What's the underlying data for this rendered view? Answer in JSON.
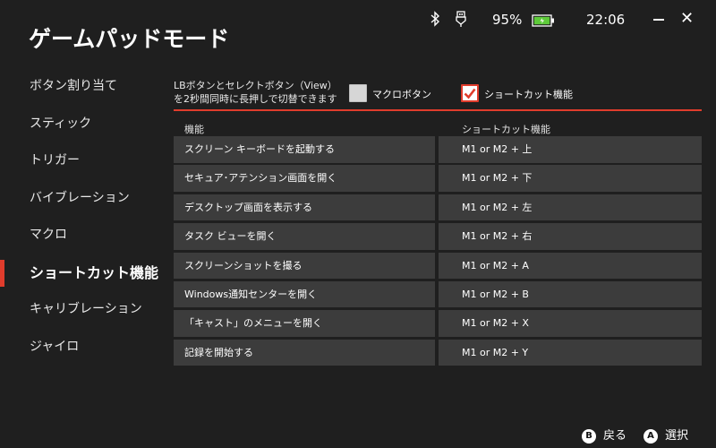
{
  "header": {
    "title": "ゲームパッドモード"
  },
  "status": {
    "battery_percent": "95%",
    "time": "22:06",
    "close_glyph": "✕"
  },
  "sidebar": {
    "items": [
      {
        "label": "ボタン割り当て",
        "active": false
      },
      {
        "label": "スティック",
        "active": false
      },
      {
        "label": "トリガー",
        "active": false
      },
      {
        "label": "バイブレーション",
        "active": false
      },
      {
        "label": "マクロ",
        "active": false
      },
      {
        "label": "ショートカット機能",
        "active": true
      },
      {
        "label": "キャリブレーション",
        "active": false
      },
      {
        "label": "ジャイロ",
        "active": false
      }
    ]
  },
  "main": {
    "description": "LBボタンとセレクトボタン（View）を2秒間同時に長押しで切替できます",
    "options": [
      {
        "label": "マクロボタン",
        "checked": false
      },
      {
        "label": "ショートカット機能",
        "checked": true
      }
    ],
    "table": {
      "headers": [
        "機能",
        "ショートカット機能"
      ],
      "rows": [
        [
          "スクリーン キーボードを起動する",
          "M1 or M2 + 上"
        ],
        [
          "セキュア･アテンション画面を開く",
          "M1 or M2 + 下"
        ],
        [
          "デスクトップ画面を表示する",
          "M1 or M2 + 左"
        ],
        [
          "タスク ビューを開く",
          "M1 or M2 + 右"
        ],
        [
          "スクリーンショットを撮る",
          "M1 or M2 + A"
        ],
        [
          "Windows通知センターを開く",
          "M1 or M2 + B"
        ],
        [
          "「キャスト」のメニューを開く",
          "M1 or M2 + X"
        ],
        [
          "記録を開始する",
          "M1 or M2 + Y"
        ]
      ]
    }
  },
  "footer": {
    "back": {
      "key": "B",
      "label": "戻る"
    },
    "select": {
      "key": "A",
      "label": "選択"
    }
  },
  "colors": {
    "accent": "#e03c2c",
    "background": "#1f1f1f",
    "cell": "#3c3c3c",
    "battery": "#5ecb3a"
  }
}
